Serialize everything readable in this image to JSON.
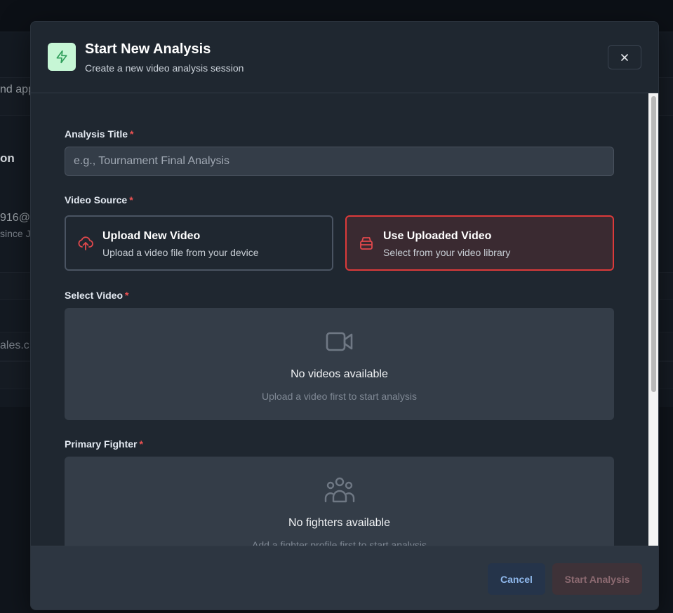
{
  "background": {
    "fragments": [
      "nd app",
      "on",
      "916@",
      "since J",
      "ales.c"
    ]
  },
  "modal": {
    "title": "Start New Analysis",
    "subtitle": "Create a new video analysis session",
    "header_icon": "lightning-bolt-icon",
    "close_icon": "close-icon",
    "required_marker": "*"
  },
  "form": {
    "analysis_title": {
      "label": "Analysis Title",
      "placeholder": "e.g., Tournament Final Analysis",
      "value": ""
    },
    "video_source": {
      "label": "Video Source",
      "selected": "use_uploaded",
      "options": [
        {
          "id": "upload_new",
          "title": "Upload New Video",
          "description": "Upload a video file from your device",
          "icon": "cloud-upload-icon"
        },
        {
          "id": "use_uploaded",
          "title": "Use Uploaded Video",
          "description": "Select from your video library",
          "icon": "archive-box-icon"
        }
      ]
    },
    "select_video": {
      "label": "Select Video",
      "empty_icon": "video-camera-icon",
      "empty_title": "No videos available",
      "empty_description": "Upload a video first to start analysis"
    },
    "primary_fighter": {
      "label": "Primary Fighter",
      "empty_icon": "user-group-icon",
      "empty_title": "No fighters available",
      "empty_description": "Add a fighter profile first to start analysis"
    }
  },
  "footer": {
    "cancel_label": "Cancel",
    "start_label": "Start Analysis"
  },
  "colors": {
    "accent_red": "#dc3a3a",
    "success_bg": "#c6f6d5",
    "success_icon": "#2f9e5a",
    "cancel_text": "#8fb8ec"
  }
}
